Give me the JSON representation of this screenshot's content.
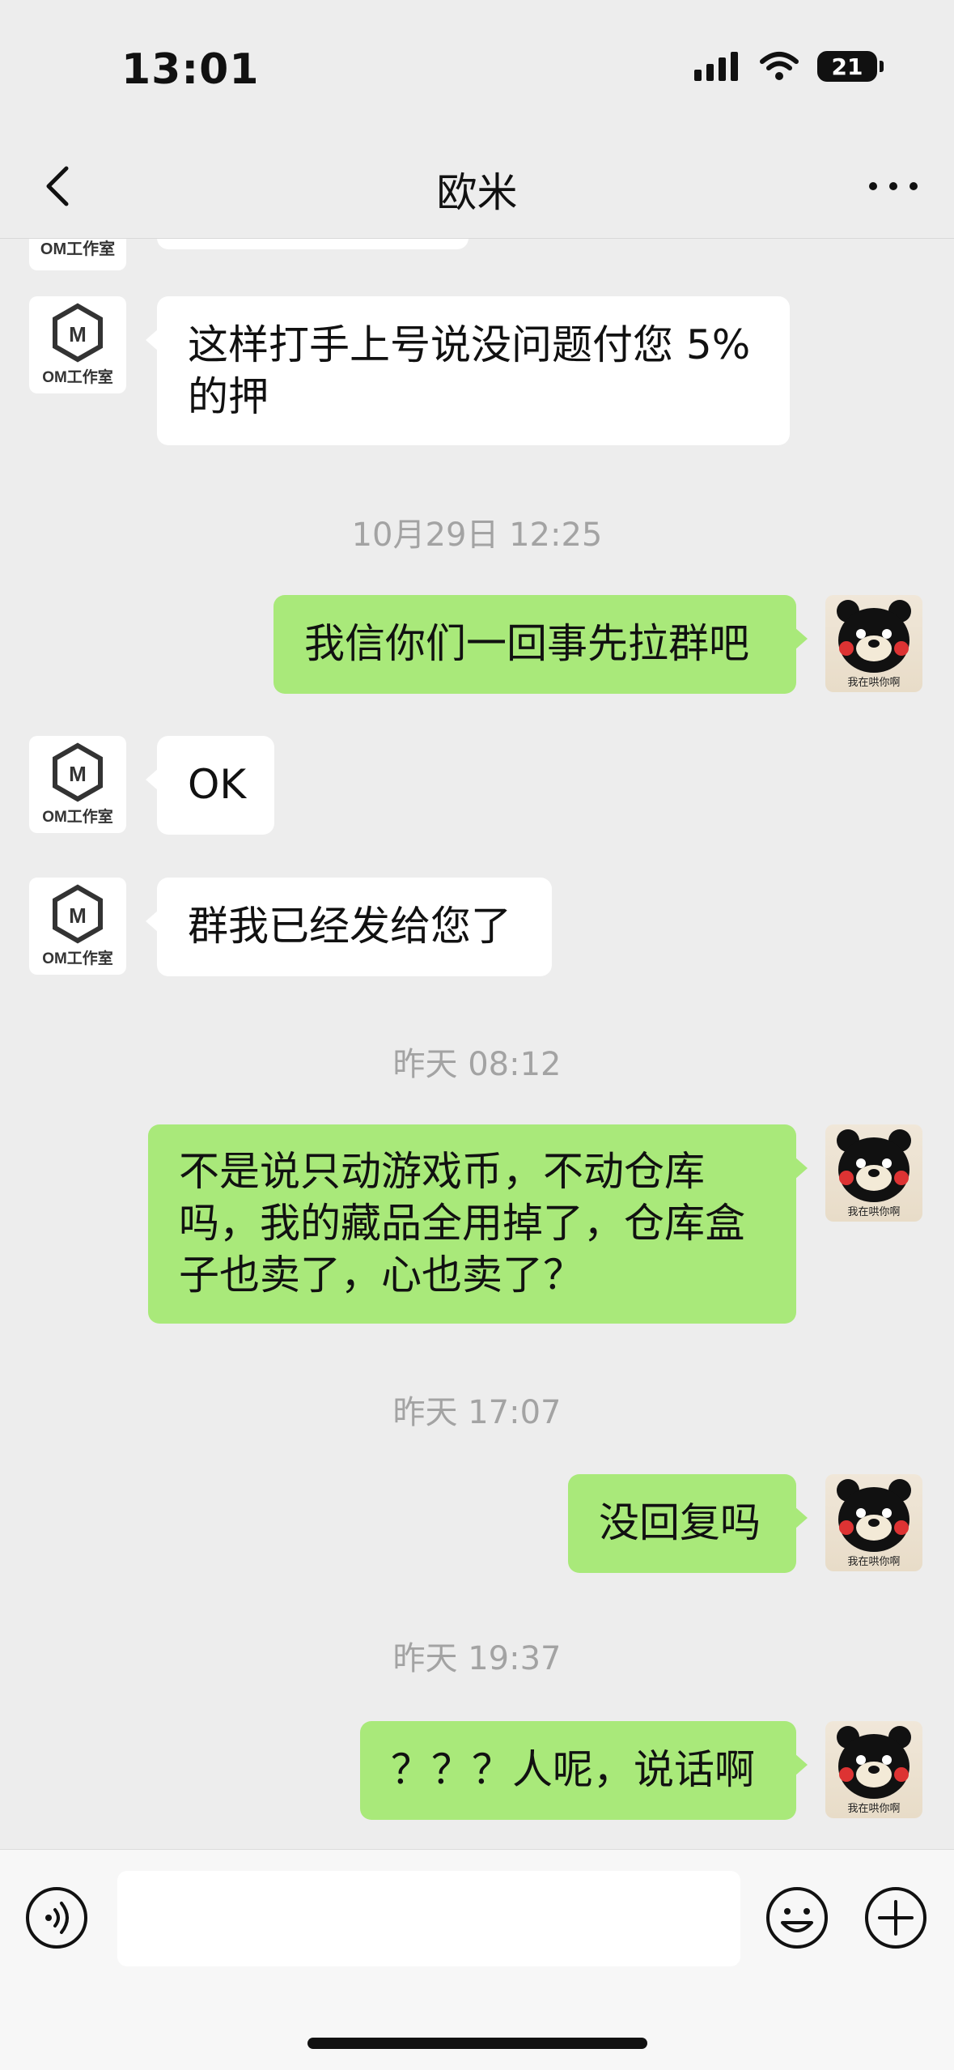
{
  "status_bar": {
    "time": "13:01",
    "battery": "21"
  },
  "nav": {
    "title": "欧米"
  },
  "avatars": {
    "om_text": "OM工作室",
    "bear_caption": "我在哄你啊"
  },
  "messages": [
    {
      "type": "in",
      "text": "这样打手上号说没问题付您 5% 的押"
    },
    {
      "type": "timestamp",
      "text": "10月29日 12:25"
    },
    {
      "type": "out",
      "text": "我信你们一回事先拉群吧"
    },
    {
      "type": "in",
      "text": "OK"
    },
    {
      "type": "in",
      "text": "群我已经发给您了"
    },
    {
      "type": "timestamp",
      "text": "昨天 08:12"
    },
    {
      "type": "out",
      "text": "不是说只动游戏币，不动仓库吗，我的藏品全用掉了，仓库盒子也卖了，心也卖了？"
    },
    {
      "type": "timestamp",
      "text": "昨天 17:07"
    },
    {
      "type": "out",
      "text": "没回复吗"
    },
    {
      "type": "timestamp",
      "text": "昨天 19:37"
    },
    {
      "type": "out",
      "text": "？？？人呢，说话啊"
    }
  ],
  "input": {
    "value": "",
    "placeholder": ""
  },
  "icons": {
    "back": "chevron-left-icon",
    "more": "more-dots-icon",
    "voice": "voice-icon",
    "emoji": "emoji-icon",
    "plus": "plus-icon"
  }
}
